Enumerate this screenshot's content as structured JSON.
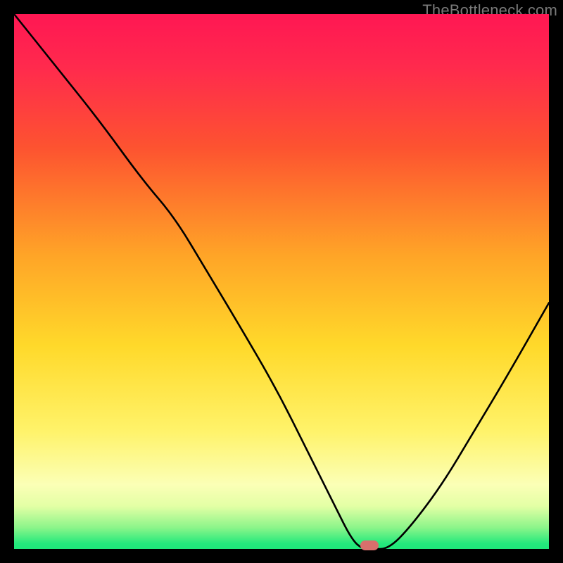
{
  "watermark": "TheBottleneck.com",
  "chart_data": {
    "type": "line",
    "title": "",
    "xlabel": "",
    "ylabel": "",
    "xlim": [
      0,
      100
    ],
    "ylim": [
      0,
      100
    ],
    "series": [
      {
        "name": "curve",
        "x": [
          0,
          8,
          16,
          24,
          30,
          36,
          42,
          49,
          55,
          60,
          63,
          65,
          67,
          70,
          74,
          80,
          86,
          92,
          100
        ],
        "y": [
          100,
          90,
          80,
          69,
          62,
          52,
          42,
          30,
          18,
          8,
          2,
          0,
          0,
          0,
          4,
          12,
          22,
          32,
          46
        ]
      }
    ],
    "marker": {
      "x": 66.5,
      "y": 0.7,
      "shape": "pill",
      "color": "#d86f6c"
    },
    "background_gradient": {
      "direction": "top-to-bottom",
      "stops": [
        {
          "pos": 0.0,
          "color": "#ff1753"
        },
        {
          "pos": 0.25,
          "color": "#fd5330"
        },
        {
          "pos": 0.45,
          "color": "#ffa427"
        },
        {
          "pos": 0.62,
          "color": "#ffd92a"
        },
        {
          "pos": 0.78,
          "color": "#fff36a"
        },
        {
          "pos": 0.92,
          "color": "#e3ffa5"
        },
        {
          "pos": 1.0,
          "color": "#1fe87a"
        }
      ]
    }
  }
}
